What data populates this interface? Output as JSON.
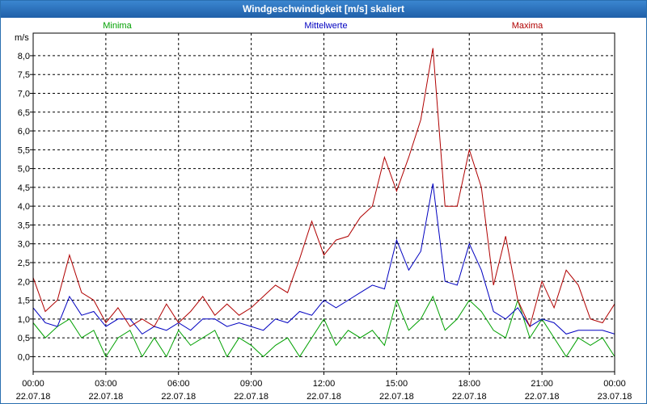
{
  "window": {
    "title": "Windgeschwindigkeit [m/s] skaliert"
  },
  "chart_data": {
    "type": "line",
    "title": "Windgeschwindigkeit [m/s] skaliert",
    "ylabel": "m/s",
    "ylim": [
      -0.4,
      8.6
    ],
    "xlim": [
      0,
      24
    ],
    "grid": true,
    "legend_placement": "top",
    "y_ticks": [
      "8,0",
      "7,5",
      "7,0",
      "6,5",
      "6,0",
      "5,5",
      "5,0",
      "4,5",
      "4,0",
      "3,5",
      "3,0",
      "2,5",
      "2,0",
      "1,5",
      "1,0",
      "0,5",
      "0,0"
    ],
    "y_tick_values": [
      8.0,
      7.5,
      7.0,
      6.5,
      6.0,
      5.5,
      5.0,
      4.5,
      4.0,
      3.5,
      3.0,
      2.5,
      2.0,
      1.5,
      1.0,
      0.5,
      0.0
    ],
    "x_ticks": [
      {
        "time": "00:00",
        "date": "22.07.18",
        "hour": 0
      },
      {
        "time": "03:00",
        "date": "22.07.18",
        "hour": 3
      },
      {
        "time": "06:00",
        "date": "22.07.18",
        "hour": 6
      },
      {
        "time": "09:00",
        "date": "22.07.18",
        "hour": 9
      },
      {
        "time": "12:00",
        "date": "22.07.18",
        "hour": 12
      },
      {
        "time": "15:00",
        "date": "22.07.18",
        "hour": 15
      },
      {
        "time": "18:00",
        "date": "22.07.18",
        "hour": 18
      },
      {
        "time": "21:00",
        "date": "22.07.18",
        "hour": 21
      },
      {
        "time": "00:00",
        "date": "23.07.18",
        "hour": 24
      }
    ],
    "series": [
      {
        "name": "Minima",
        "color": "#00a000",
        "x": [
          0,
          0.5,
          1,
          1.5,
          2,
          2.5,
          3,
          3.5,
          4,
          4.5,
          5,
          5.5,
          6,
          6.5,
          7,
          7.5,
          8,
          8.5,
          9,
          9.5,
          10,
          10.5,
          11,
          11.5,
          12,
          12.5,
          13,
          13.5,
          14,
          14.5,
          15,
          15.5,
          16,
          16.5,
          17,
          17.5,
          18,
          18.5,
          19,
          19.5,
          20,
          20.5,
          21,
          21.5,
          22,
          22.5,
          23,
          23.5,
          24
        ],
        "values": [
          0.9,
          0.5,
          0.8,
          1.0,
          0.5,
          0.7,
          0.0,
          0.5,
          0.7,
          0.0,
          0.5,
          0.0,
          0.7,
          0.3,
          0.5,
          0.7,
          0.0,
          0.5,
          0.3,
          0.0,
          0.3,
          0.5,
          0.0,
          0.5,
          1.0,
          0.3,
          0.7,
          0.5,
          0.7,
          0.3,
          1.5,
          0.7,
          1.0,
          1.6,
          0.7,
          1.0,
          1.5,
          1.2,
          0.7,
          0.5,
          1.5,
          0.5,
          1.0,
          0.5,
          0.0,
          0.5,
          0.3,
          0.5,
          0.0
        ]
      },
      {
        "name": "Mittelwerte",
        "color": "#0000c0",
        "x": [
          0,
          0.5,
          1,
          1.5,
          2,
          2.5,
          3,
          3.5,
          4,
          4.5,
          5,
          5.5,
          6,
          6.5,
          7,
          7.5,
          8,
          8.5,
          9,
          9.5,
          10,
          10.5,
          11,
          11.5,
          12,
          12.5,
          13,
          13.5,
          14,
          14.5,
          15,
          15.5,
          16,
          16.5,
          17,
          17.5,
          18,
          18.5,
          19,
          19.5,
          20,
          20.5,
          21,
          21.5,
          22,
          22.5,
          23,
          23.5,
          24
        ],
        "values": [
          1.3,
          0.9,
          0.8,
          1.6,
          1.1,
          1.2,
          0.8,
          1.0,
          1.0,
          0.6,
          0.8,
          0.7,
          0.9,
          0.7,
          1.0,
          1.0,
          0.8,
          0.9,
          0.8,
          0.7,
          1.0,
          0.9,
          1.2,
          1.1,
          1.5,
          1.3,
          1.5,
          1.7,
          1.9,
          1.8,
          3.1,
          2.3,
          2.8,
          4.6,
          2.0,
          1.9,
          3.0,
          2.3,
          1.2,
          1.0,
          1.3,
          0.8,
          1.0,
          0.9,
          0.6,
          0.7,
          0.7,
          0.7,
          0.6
        ]
      },
      {
        "name": "Maxima",
        "color": "#b00000",
        "x": [
          0,
          0.5,
          1,
          1.5,
          2,
          2.5,
          3,
          3.5,
          4,
          4.5,
          5,
          5.5,
          6,
          6.5,
          7,
          7.5,
          8,
          8.5,
          9,
          9.5,
          10,
          10.5,
          11,
          11.5,
          12,
          12.5,
          13,
          13.5,
          14,
          14.5,
          15,
          15.5,
          16,
          16.5,
          17,
          17.5,
          18,
          18.5,
          19,
          19.5,
          20,
          20.5,
          21,
          21.5,
          22,
          22.5,
          23,
          23.5,
          24
        ],
        "values": [
          2.1,
          1.2,
          1.5,
          2.7,
          1.7,
          1.5,
          0.9,
          1.3,
          0.8,
          1.0,
          0.8,
          1.4,
          0.9,
          1.2,
          1.6,
          1.1,
          1.4,
          1.1,
          1.3,
          1.6,
          1.9,
          1.7,
          2.6,
          3.6,
          2.7,
          3.1,
          3.2,
          3.7,
          4.0,
          5.3,
          4.4,
          5.3,
          6.3,
          8.2,
          4.0,
          4.0,
          5.5,
          4.5,
          1.9,
          3.2,
          1.5,
          0.8,
          2.0,
          1.3,
          2.3,
          1.9,
          1.0,
          0.9,
          1.4
        ]
      }
    ]
  }
}
